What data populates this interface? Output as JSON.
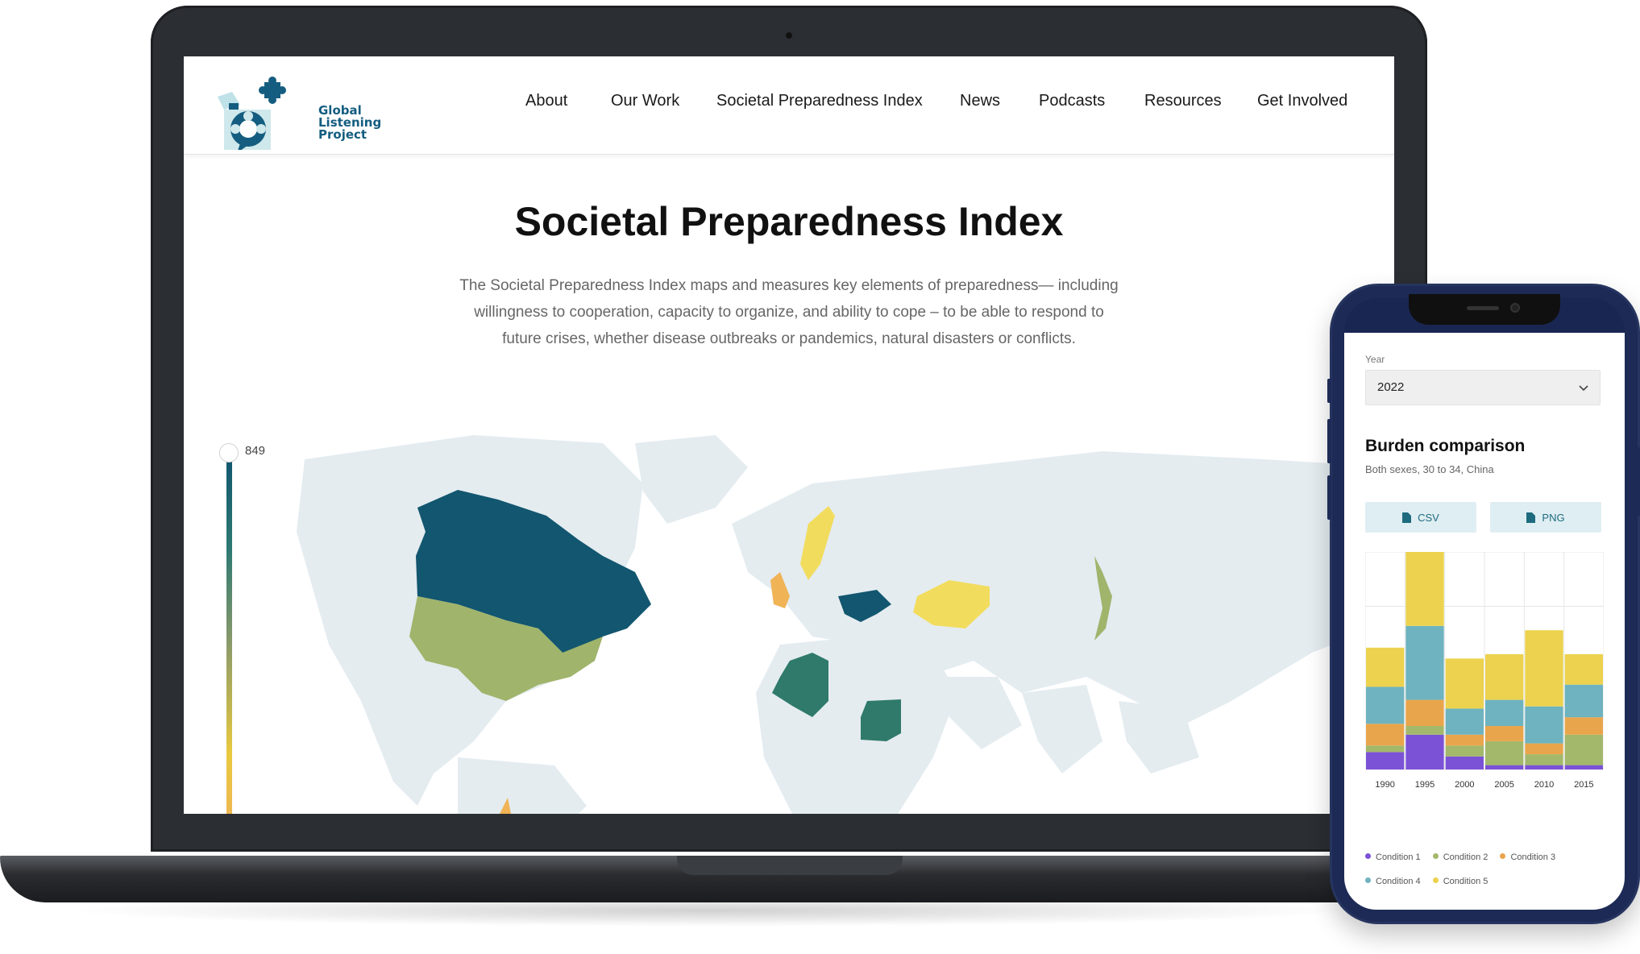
{
  "site": {
    "logo_lines": [
      "Global",
      "Listening",
      "Project"
    ],
    "nav": [
      "About",
      "Our Work",
      "Societal Preparedness Index",
      "News",
      "Podcasts",
      "Resources",
      "Get Involved"
    ]
  },
  "hero": {
    "title": "Societal Preparedness Index",
    "intro": "The Societal Preparedness Index maps and measures key elements of preparedness— including willingness to cooperation, capacity to organize, and ability to cope – to be able to respond to future crises, whether disease outbreaks or pandemics, natural disasters or conflicts."
  },
  "map": {
    "legend_value": "849",
    "colors": {
      "high": "#12566f",
      "mid_high": "#2f7a6a",
      "mid": "#9fb06a",
      "low": "#f2dc5d",
      "lowest": "#f0b356",
      "base": "#e4ecf0"
    }
  },
  "phone": {
    "year_label": "Year",
    "year_value": "2022",
    "title": "Burden comparison",
    "subtitle": "Both sexes, 30 to 34, China",
    "buttons": [
      "CSV",
      "PNG"
    ],
    "legend": [
      {
        "name": "Condition 1",
        "color": "#7b52d6"
      },
      {
        "name": "Condition 2",
        "color": "#a3b86a"
      },
      {
        "name": "Condition 3",
        "color": "#e9a54b"
      },
      {
        "name": "Condition 4",
        "color": "#6eb3bf"
      },
      {
        "name": "Condition 5",
        "color": "#ecd24e"
      }
    ]
  },
  "chart_data": {
    "type": "bar",
    "stacked": true,
    "categories": [
      "1990",
      "1995",
      "2000",
      "2005",
      "2010",
      "2015"
    ],
    "series": [
      {
        "name": "Condition 1",
        "values": [
          8,
          16,
          6,
          2,
          2,
          2
        ]
      },
      {
        "name": "Condition 2",
        "values": [
          3,
          4,
          5,
          11,
          5,
          14
        ]
      },
      {
        "name": "Condition 3",
        "values": [
          10,
          12,
          5,
          7,
          5,
          8
        ]
      },
      {
        "name": "Condition 4",
        "values": [
          17,
          34,
          12,
          12,
          17,
          15
        ]
      },
      {
        "name": "Condition 5",
        "values": [
          18,
          41,
          23,
          21,
          35,
          14
        ]
      }
    ],
    "ylim": [
      0,
      100
    ],
    "grid": true
  }
}
